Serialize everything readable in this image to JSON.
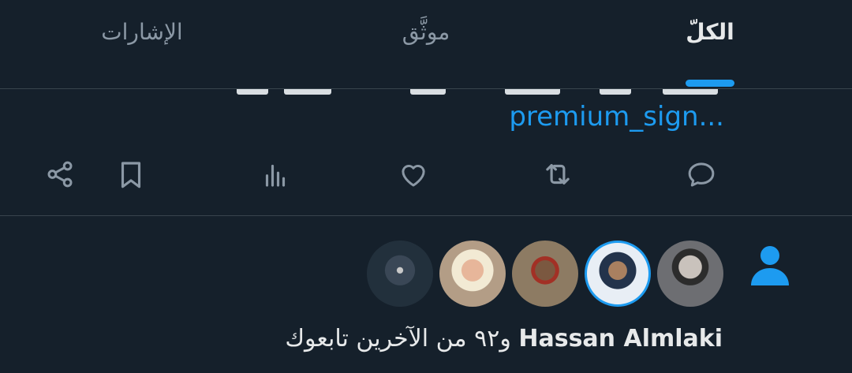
{
  "tabs": {
    "all": "الكلّ",
    "verified": "موثَّق",
    "mentions": "الإشارات"
  },
  "tweet": {
    "link": "premium_sign..."
  },
  "actions": {
    "reply": "reply-icon",
    "retweet": "retweet-icon",
    "like": "heart-icon",
    "views": "views-icon",
    "bookmark": "bookmark-icon",
    "share": "share-icon"
  },
  "notification": {
    "name": "Hassan Almlaki",
    "rest": " و٩٢ من الآخرين تابعوك"
  },
  "colors": {
    "background": "#15202b",
    "accent": "#1d9bf0",
    "muted": "#8b98a5",
    "divider": "#38444d"
  }
}
